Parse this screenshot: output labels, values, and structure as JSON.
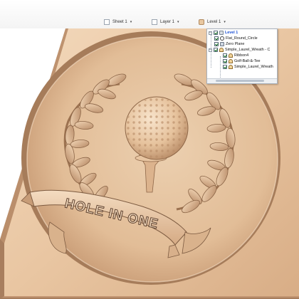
{
  "toolbar": {
    "sheet_label": "Sheet 1",
    "layer_label": "Layer 1",
    "level_label": "Level 1",
    "caret": "▾"
  },
  "tree": {
    "root": {
      "label": "Level 1",
      "checked": true,
      "expanded": true,
      "selected": true
    },
    "items": [
      {
        "label": "Flat_Round_Circle",
        "checked": true,
        "icon": "ring-icon"
      },
      {
        "label": "Zero Plane",
        "checked": true,
        "icon": "plane-icon"
      },
      {
        "label": "Simple_Laurel_Wreath - C",
        "checked": true,
        "icon": "relief-icon",
        "expanded": true,
        "children": [
          {
            "label": "Ribbon4",
            "checked": true,
            "icon": "relief-icon"
          },
          {
            "label": "Golf-Ball-&-Tee",
            "checked": true,
            "icon": "relief-icon"
          },
          {
            "label": "Simple_Laurel_Wreath",
            "checked": true,
            "icon": "relief-icon"
          }
        ]
      }
    ]
  },
  "scene": {
    "banner_text": "HOLE IN ONE",
    "colors": {
      "wood_light": "#f0d2b2",
      "wood_mid": "#ddb48c",
      "wood_dark": "#a97f5d",
      "shadow": "#6e4e38",
      "selection_blue": "#1a4fd4"
    }
  }
}
